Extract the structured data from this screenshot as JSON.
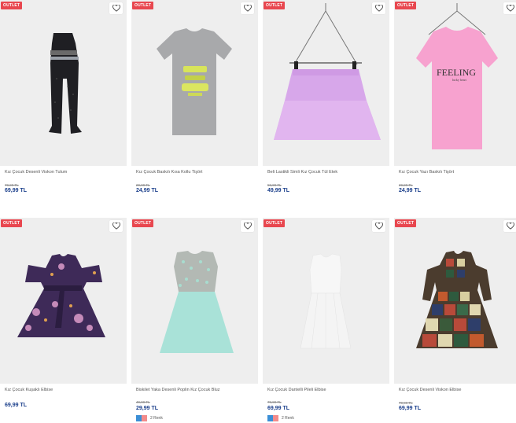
{
  "products": [
    {
      "name": "Kız Çocuk Desenli Viskon Tulum",
      "old_price": "79,99 TL",
      "price": "69,99 TL",
      "badge": "OUTLET",
      "colors_label": ""
    },
    {
      "name": "Kız Çocuk Baskılı Kısa Kollu Tişört",
      "old_price": "29,99 TL",
      "price": "24,99 TL",
      "badge": "OUTLET",
      "colors_label": ""
    },
    {
      "name": "Beli Lastikli Simli Kız Çocuk Tül Etek",
      "old_price": "59,99 TL",
      "price": "49,99 TL",
      "badge": "OUTLET",
      "colors_label": ""
    },
    {
      "name": "Kız Çocuk Yazı Baskılı Tişört",
      "old_price": "29,99 TL",
      "price": "24,99 TL",
      "badge": "OUTLET",
      "colors_label": ""
    },
    {
      "name": "Kız Çocuk Kuşaklı Elbise",
      "old_price": "",
      "price": "69,99 TL",
      "badge": "OUTLET",
      "colors_label": ""
    },
    {
      "name": "Biskilet Yaka Desenli Poplin Kız Çocuk Bluz",
      "old_price": "49,99 TL",
      "price": "29,99 TL",
      "badge": "OUTLET",
      "colors_label": "2 Renk"
    },
    {
      "name": "Kız Çocuk Dantelli Pileli Elbise",
      "old_price": "79,99 TL",
      "price": "69,99 TL",
      "badge": "OUTLET",
      "colors_label": "2 Renk"
    },
    {
      "name": "Kız Çocuk Desenli Viskon Elbise",
      "old_price": "79,99 TL",
      "price": "69,99 TL",
      "badge": "OUTLET",
      "colors_label": ""
    }
  ],
  "graphic_text": {
    "tshirt_print": "FEELING",
    "tshirt_sub": "lucky heart"
  },
  "colors": {
    "badge": "#e8474f",
    "price": "#1b3f8b",
    "card_bg": "#eeeeee"
  },
  "icons": {
    "favorite": "heart-outline-icon"
  }
}
